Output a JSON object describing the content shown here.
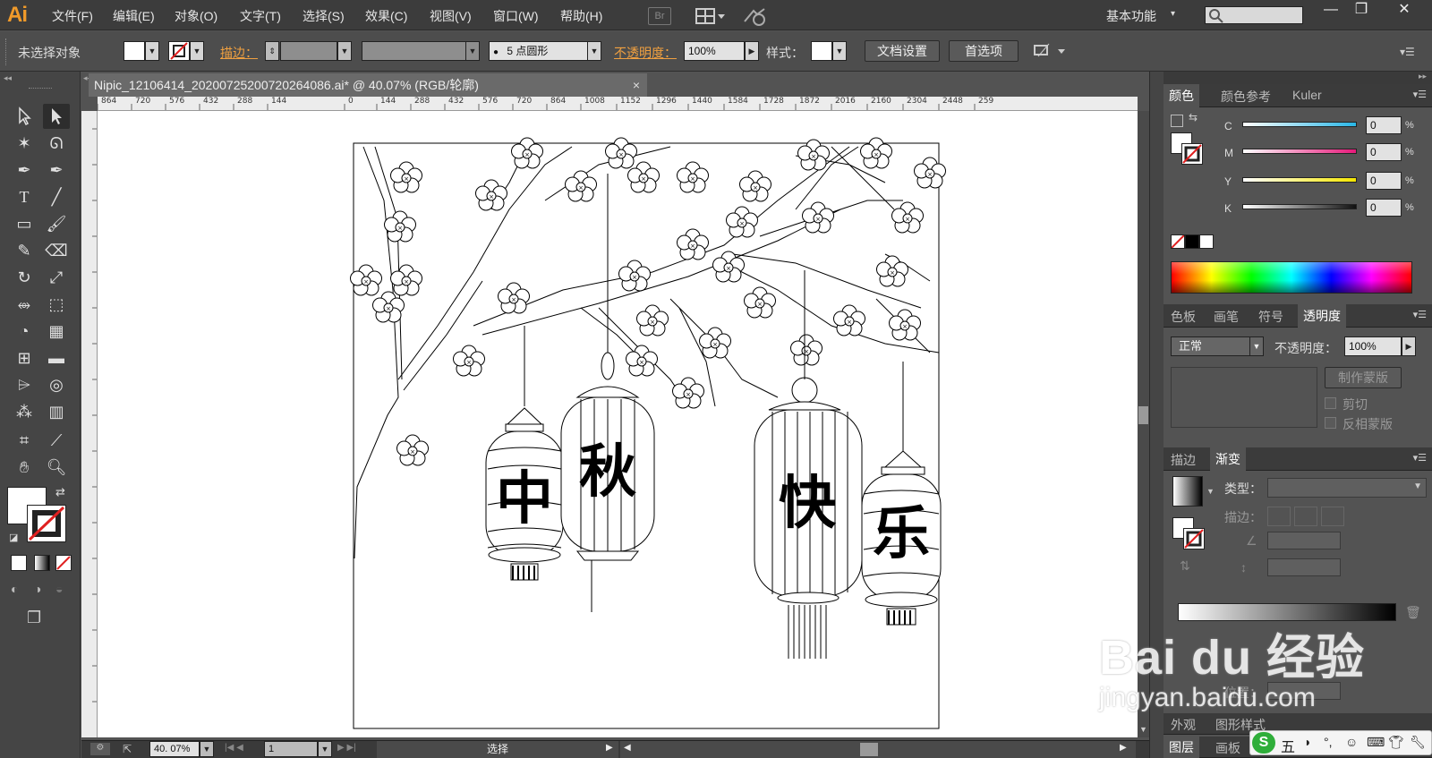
{
  "app": {
    "logo": "Ai"
  },
  "menubar": {
    "items": [
      "文件(F)",
      "编辑(E)",
      "对象(O)",
      "文字(T)",
      "选择(S)",
      "效果(C)",
      "视图(V)",
      "窗口(W)",
      "帮助(H)"
    ],
    "bridge_label": "Br",
    "workspace": "基本功能",
    "window_controls": [
      "minimize-icon",
      "restore-icon",
      "close-icon"
    ]
  },
  "control_bar": {
    "selection_status": "未选择对象",
    "stroke_label": "描边：",
    "brush_value": "5 点圆形",
    "opacity_label": "不透明度：",
    "opacity_value": "100%",
    "style_label": "样式：",
    "doc_setup_button": "文档设置",
    "prefs_button": "首选项"
  },
  "document": {
    "tab_title": "Nipic_12106414_20200725200720264086.ai* @ 40.07% (RGB/轮廓)",
    "ruler_ticks": [
      "864",
      "720",
      "576",
      "432",
      "288",
      "144",
      "0",
      "144",
      "288",
      "432",
      "576",
      "720",
      "864",
      "1008",
      "1152",
      "1296",
      "1440",
      "1584",
      "1728",
      "1872",
      "2016",
      "2160",
      "2304",
      "2448",
      "259"
    ],
    "artwork_characters": [
      "中",
      "秋",
      "快",
      "乐"
    ]
  },
  "statusbar": {
    "zoom": "40. 07%",
    "page": "1",
    "tool_status": "选择"
  },
  "color_panel": {
    "tabs": [
      "颜色",
      "颜色参考",
      "Kuler"
    ],
    "channels": [
      {
        "name": "C",
        "value": "0",
        "color": "#29b6e6"
      },
      {
        "name": "M",
        "value": "0",
        "color": "#e6197a"
      },
      {
        "name": "Y",
        "value": "0",
        "color": "#f4e600"
      },
      {
        "name": "K",
        "value": "0",
        "color": "#111111"
      }
    ],
    "percent": "%"
  },
  "transparency_panel": {
    "tabs": [
      "色板",
      "画笔",
      "符号",
      "透明度"
    ],
    "blend_mode": "正常",
    "opacity_label": "不透明度：",
    "opacity_value": "100%",
    "make_mask_button": "制作蒙版",
    "clip_label": "剪切",
    "invert_label": "反相蒙版"
  },
  "gradient_panel": {
    "tabs": [
      "描边",
      "渐变"
    ],
    "type_label": "类型：",
    "stroke_label": "描边：",
    "position_label": "位置："
  },
  "bottom_panels": {
    "tabs_row1": [
      "外观",
      "图形样式"
    ],
    "tabs_row2": [
      "图层",
      "画板"
    ]
  },
  "watermark": {
    "logo_text": "Bai du 经验",
    "url": "jingyan.baidu.com"
  },
  "ime": {
    "label": "五"
  }
}
